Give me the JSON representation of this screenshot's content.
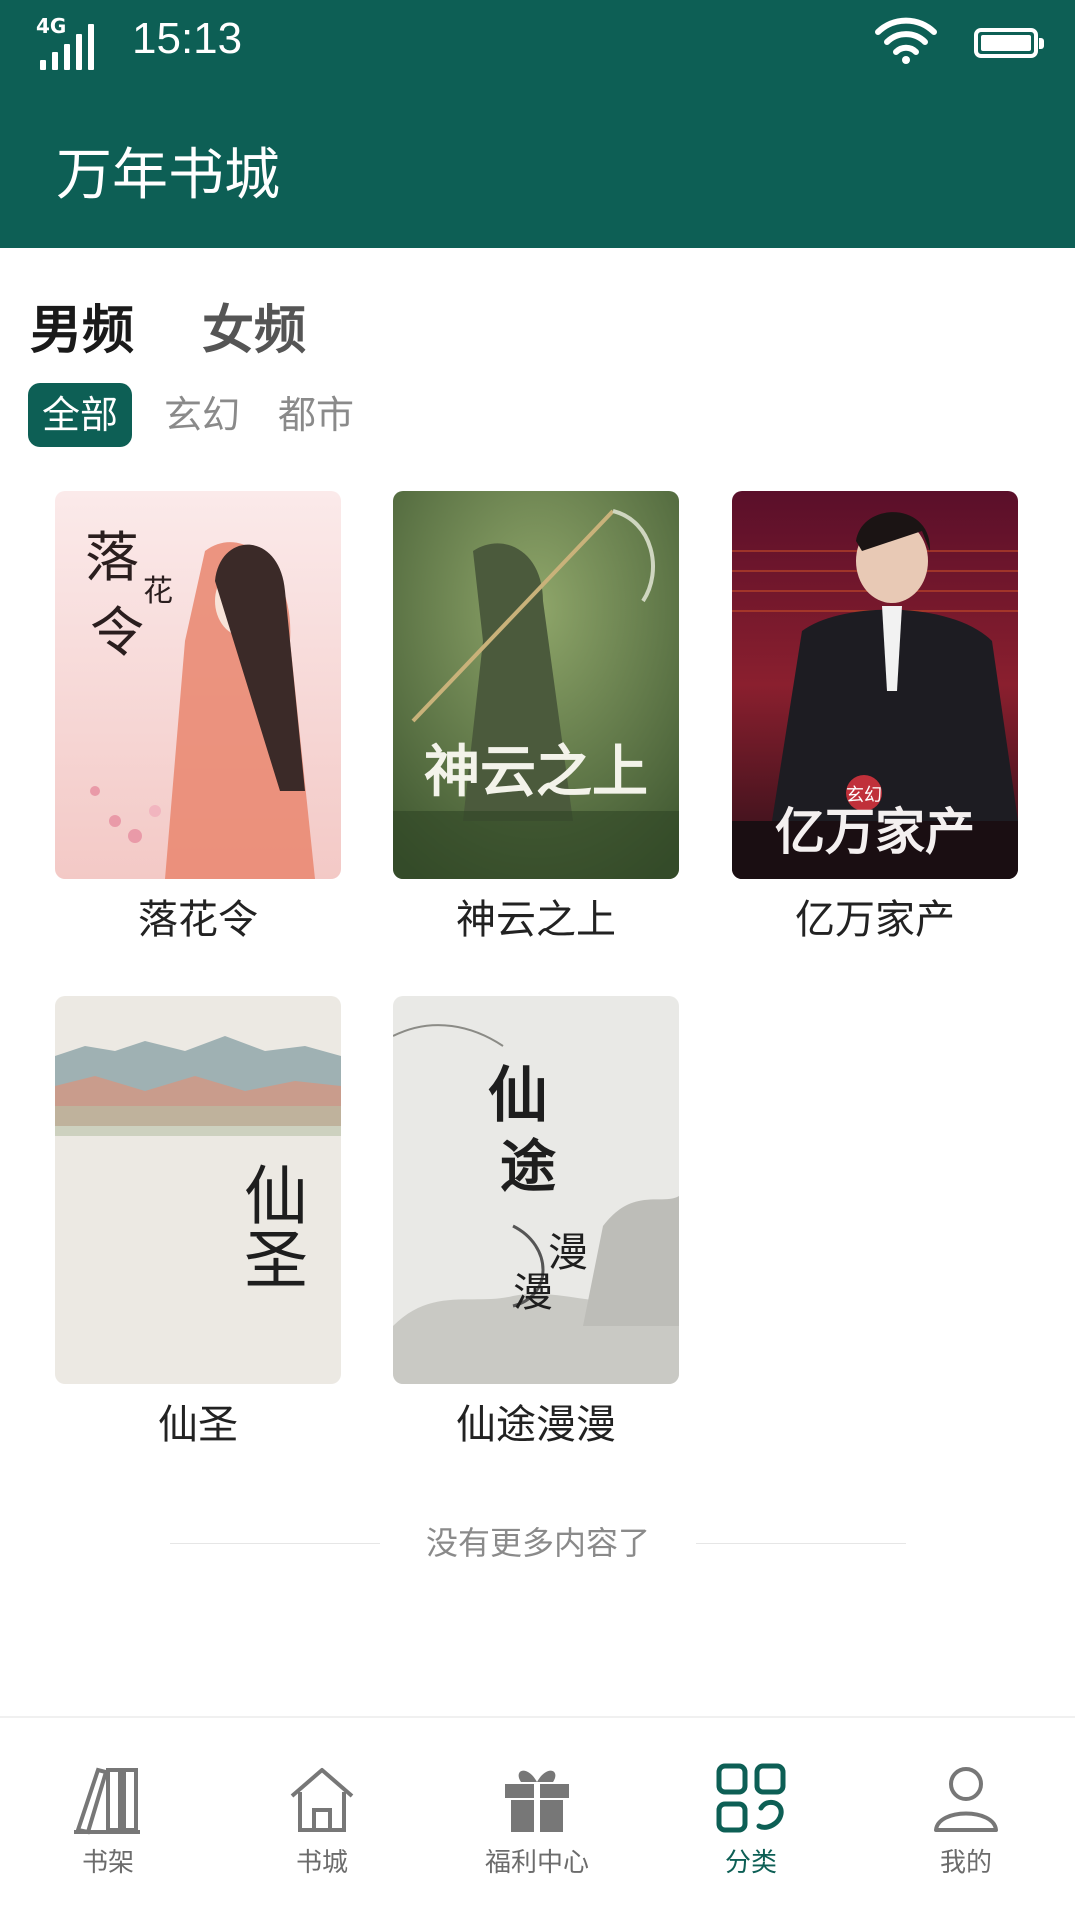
{
  "status_bar": {
    "network": "4G",
    "time": "15:13"
  },
  "app_bar": {
    "title": "万年书城"
  },
  "gender_tabs": [
    {
      "label": "男频",
      "active": true
    },
    {
      "label": "女频",
      "active": false
    }
  ],
  "categories": [
    {
      "label": "全部",
      "active": true
    },
    {
      "label": "玄幻",
      "active": false
    },
    {
      "label": "都市",
      "active": false
    }
  ],
  "books": [
    {
      "title": "落花令",
      "cover_text": [
        "落",
        "花",
        "令"
      ]
    },
    {
      "title": "神云之上",
      "cover_text": "神云之上"
    },
    {
      "title": "亿万家产",
      "cover_text": "亿万家产",
      "cover_badge": "玄幻"
    },
    {
      "title": "仙圣",
      "cover_text": "仙圣"
    },
    {
      "title": "仙途漫漫",
      "cover_text": [
        "仙",
        "途",
        "漫",
        "漫"
      ]
    }
  ],
  "end_message": "没有更多内容了",
  "bottom_nav": [
    {
      "label": "书架",
      "icon": "bookshelf-icon",
      "active": false
    },
    {
      "label": "书城",
      "icon": "home-icon",
      "active": false
    },
    {
      "label": "福利中心",
      "icon": "gift-icon",
      "active": false
    },
    {
      "label": "分类",
      "icon": "category-icon",
      "active": true
    },
    {
      "label": "我的",
      "icon": "user-icon",
      "active": false
    }
  ],
  "colors": {
    "primary": "#0d5f55",
    "inactive_text": "#8a8a8a"
  }
}
